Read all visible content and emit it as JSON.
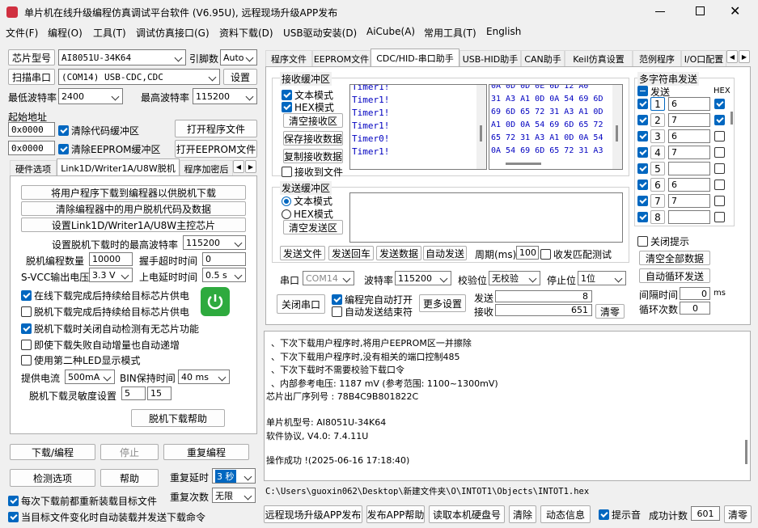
{
  "title": "单片机在线升级编程仿真调试平台软件 (V6.95U), 远程现场升级APP发布",
  "menu": [
    "文件(F)",
    "编程(O)",
    "工具(T)",
    "调试仿真接口(G)",
    "资料下载(D)",
    "USB驱动安装(D)",
    "AiCube(A)",
    "常用工具(T)",
    "English"
  ],
  "left": {
    "chip_label": "芯片型号",
    "chip_value": "AI8051U-34K64",
    "pin_label": "引脚数",
    "pin_value": "Auto",
    "scan_btn": "扫描串口",
    "port_value": "(COM14) USB-CDC,CDC",
    "settings_btn": "设置",
    "min_baud_label": "最低波特率",
    "min_baud": "2400",
    "max_baud_label": "最高波特率",
    "max_baud": "115200",
    "start_addr_label": "起始地址",
    "addr1": "0x0000",
    "addr2": "0x0000",
    "clear_code": "清除代码缓冲区",
    "clear_eeprom": "清除EEPROM缓冲区",
    "open_prog": "打开程序文件",
    "open_eeprom": "打开EEPROM文件",
    "tabs": [
      "硬件选项",
      "Link1D/Writer1A/U8W脱机",
      "程序加密后"
    ],
    "btn1": "将用户程序下载到编程器以供脱机下载",
    "btn2": "清除编程器中的用户脱机代码及数据",
    "btn3": "设置Link1D/Writer1A/U8W主控芯片",
    "max_baud_offline": "设置脱机下载时的最高波特率",
    "max_baud_offline_v": "115200",
    "offline_count": "脱机编程数量",
    "offline_count_v": "10000",
    "handshake": "握手超时时间",
    "handshake_v": "0",
    "svcc": "S-VCC输出电压",
    "svcc_v": "3.3 V",
    "power_delay": "上电延时时间",
    "power_delay_v": "0.5 s",
    "opt1": "在线下载完成后持续给目标芯片供电",
    "opt2": "脱机下载完成后持续给目标芯片供电",
    "opt3": "脱机下载时关闭自动检测有无芯片功能",
    "opt4": "即使下载失败自动增量也自动递增",
    "opt5": "使用第二种LED显示模式",
    "current": "提供电流",
    "current_v": "500mA",
    "bin_time": "BIN保持时间",
    "bin_time_v": "40 ms",
    "sensitivity": "脱机下载灵敏度设置",
    "sens1": "5",
    "sens2": "15",
    "offline_help": "脱机下载帮助",
    "download": "下载/编程",
    "stop": "停止",
    "reprog": "重复编程",
    "check": "检测选项",
    "help": "帮助",
    "repeat_delay": "重复延时",
    "repeat_delay_v": "3 秒",
    "repeat_count": "重复次数",
    "repeat_count_v": "无限",
    "reload": "每次下载前都重新装载目标文件",
    "auto_send": "当目标文件变化时自动装载并发送下载命令"
  },
  "right_tabs": [
    "程序文件",
    "EEPROM文件",
    "CDC/HID-串口助手",
    "USB-HID助手",
    "CAN助手",
    "Keil仿真设置",
    "范例程序",
    "I/O口配置"
  ],
  "rx": {
    "title": "接收缓冲区",
    "text_mode": "文本模式",
    "hex_mode": "HEX模式",
    "clear": "清空接收区",
    "save": "保存接收数据",
    "copy": "复制接收数据",
    "to_file": "接收到文件",
    "lines": [
      "Timer1!",
      "Timer1!",
      "Timer1!",
      "Timer1!",
      "Timer0!",
      "Timer1!"
    ],
    "hex": [
      "31 A3 A1 0D 0A 54 69 6D",
      "69 6D 65 72 31 A3 A1 0D",
      "A1 0D 0A 54 69 6D 65 72",
      "65 72 31 A3 A1 0D 0A 54",
      "0A 54 69 6D 65 72 31 A3"
    ]
  },
  "tx": {
    "title": "发送缓冲区",
    "text_mode": "文本模式",
    "hex_mode": "HEX模式",
    "clear": "清空发送区",
    "send_file": "发送文件",
    "send_return": "发送回车",
    "send_data": "发送数据",
    "auto_send": "自动发送",
    "period": "周期(ms)",
    "period_v": "100",
    "match": "收发匹配测试"
  },
  "serial": {
    "port_label": "串口",
    "port": "COM14",
    "baud_label": "波特率",
    "baud": "115200",
    "parity_label": "校验位",
    "parity": "无校验",
    "stop_label": "停止位",
    "stop": "1位",
    "close": "关闭串口",
    "auto_open": "编程完自动打开",
    "auto_end": "自动发送结束符",
    "more": "更多设置",
    "send_label": "发送",
    "send_v": "8",
    "recv_label": "接收",
    "recv_v": "651",
    "clear": "清零"
  },
  "multi": {
    "title": "多字符串发送",
    "send": "发送",
    "hex": "HEX",
    "rows": [
      {
        "n": "1",
        "v": "6"
      },
      {
        "n": "2",
        "v": "7"
      },
      {
        "n": "3",
        "v": "6"
      },
      {
        "n": "4",
        "v": "7"
      },
      {
        "n": "5",
        "v": ""
      },
      {
        "n": "6",
        "v": "6"
      },
      {
        "n": "7",
        "v": "7"
      },
      {
        "n": "8",
        "v": ""
      }
    ],
    "close_tip": "关闭提示",
    "clear_all": "清空全部数据",
    "auto_loop": "自动循环发送",
    "interval": "间隔时间",
    "interval_v": "0",
    "ms": "ms",
    "loops": "循环次数",
    "loops_v": "0"
  },
  "log": [
    "、下次下载用户程序时,将用户EEPROM区一并擦除",
    "、下次下载用户程序时,没有相关的端口控制485",
    "、下次下载时不需要校验下载口令",
    "、内部参考电压: 1187 mV (参考范围: 1100~1300mV)",
    "芯片出厂序列号 : 78B4C9B801822C",
    "",
    "  单片机型号: AI8051U-34K64",
    "  软件协议, V4.0: 7.4.11U",
    "",
    "操作成功 !(2025-06-16 17:18:40)"
  ],
  "path": "C:\\Users\\guoxin062\\Desktop\\新建文件夹\\O\\INTOT1\\Objects\\INTOT1.hex",
  "bottom": {
    "remote": "远程现场升级APP发布",
    "publish_help": "发布APP帮助",
    "read_disk": "读取本机硬盘号",
    "clear": "清除",
    "dynamic": "动态信息",
    "beep": "提示音",
    "success": "成功计数",
    "success_v": "601",
    "reset": "清零"
  }
}
